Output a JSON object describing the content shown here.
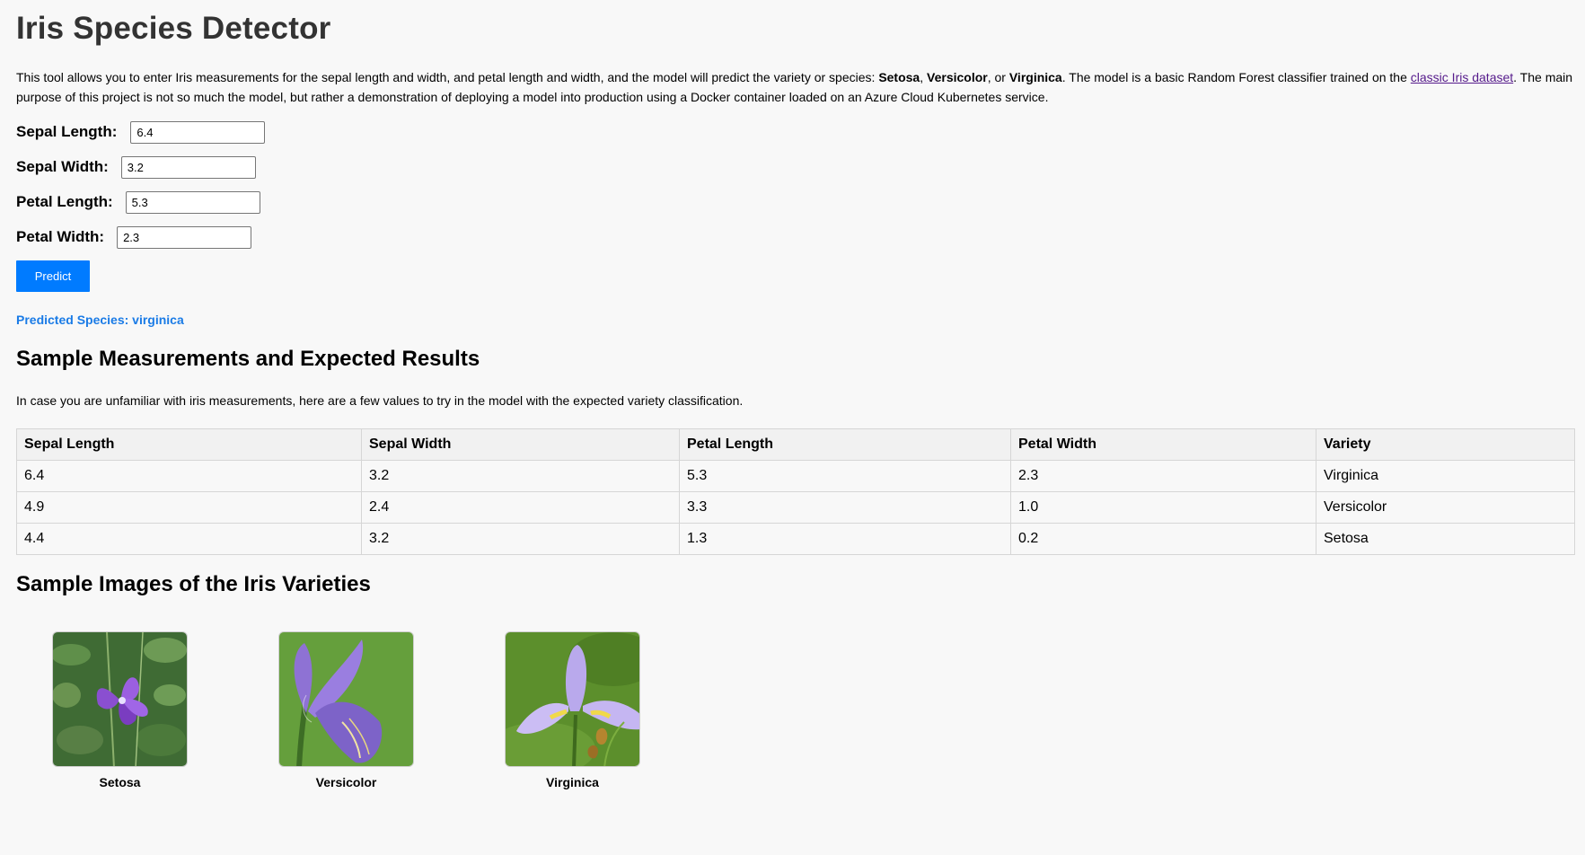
{
  "page": {
    "title": "Iris Species Detector",
    "intro": {
      "part1": "This tool allows you to enter Iris measurements for the sepal length and width, and petal length and width, and the model will predict the variety or species: ",
      "setosa": "Setosa",
      "comma": ", ",
      "versicolor": "Versicolor",
      "or": ", or ",
      "virginica": "Virginica",
      "part2": ". The model is a basic Random Forest classifier trained on the ",
      "link": "classic Iris dataset",
      "part3": ". The main purpose of this project is not so much the model, but rather a demonstration of deploying a model into production using a Docker container loaded on an Azure Cloud Kubernetes service."
    }
  },
  "form": {
    "sepal_length": {
      "label": "Sepal Length:",
      "value": "6.4"
    },
    "sepal_width": {
      "label": "Sepal Width:",
      "value": "3.2"
    },
    "petal_length": {
      "label": "Petal Length:",
      "value": "5.3"
    },
    "petal_width": {
      "label": "Petal Width:",
      "value": "2.3"
    },
    "predict_label": "Predict"
  },
  "result": "Predicted Species: virginica",
  "samples": {
    "heading": "Sample Measurements and Expected Results",
    "description": "In case you are unfamiliar with iris measurements, here are a few values to try in the model with the expected variety classification.",
    "columns": [
      "Sepal Length",
      "Sepal Width",
      "Petal Length",
      "Petal Width",
      "Variety"
    ],
    "rows": [
      [
        "6.4",
        "3.2",
        "5.3",
        "2.3",
        "Virginica"
      ],
      [
        "4.9",
        "2.4",
        "3.3",
        "1.0",
        "Versicolor"
      ],
      [
        "4.4",
        "3.2",
        "1.3",
        "0.2",
        "Setosa"
      ]
    ]
  },
  "images": {
    "heading": "Sample Images of the Iris Varieties",
    "cards": [
      {
        "caption": "Setosa"
      },
      {
        "caption": "Versicolor"
      },
      {
        "caption": "Virginica"
      }
    ]
  },
  "colors": {
    "accent": "#007bff",
    "result": "#1a7be6",
    "link_visited": "#551a8b",
    "background": "#f8f8f8"
  }
}
